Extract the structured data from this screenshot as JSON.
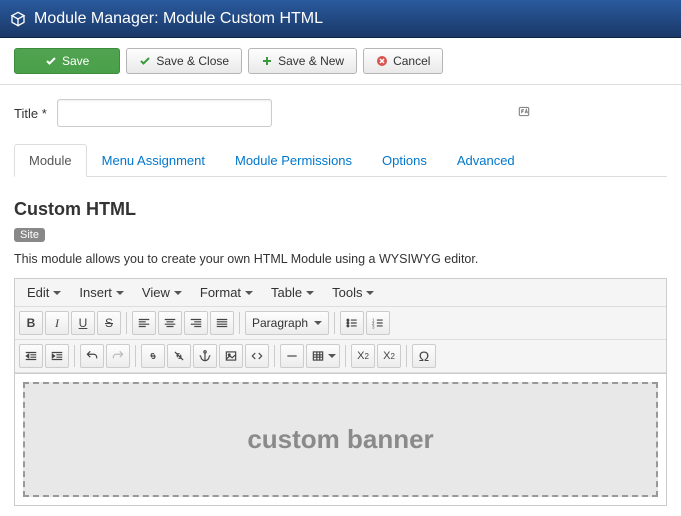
{
  "header": {
    "title": "Module Manager: Module Custom HTML"
  },
  "toolbar": {
    "save": "Save",
    "saveClose": "Save & Close",
    "saveNew": "Save & New",
    "cancel": "Cancel"
  },
  "form": {
    "titleLabel": "Title *",
    "titleValue": ""
  },
  "tabs": {
    "module": "Module",
    "menuAssignment": "Menu Assignment",
    "modulePermissions": "Module Permissions",
    "options": "Options",
    "advanced": "Advanced"
  },
  "module": {
    "heading": "Custom HTML",
    "badge": "Site",
    "description": "This module allows you to create your own HTML Module using a WYSIWYG editor."
  },
  "editor": {
    "menus": {
      "edit": "Edit",
      "insert": "Insert",
      "view": "View",
      "format": "Format",
      "table": "Table",
      "tools": "Tools"
    },
    "paragraphSelect": "Paragraph",
    "canvasText": "custom banner"
  }
}
